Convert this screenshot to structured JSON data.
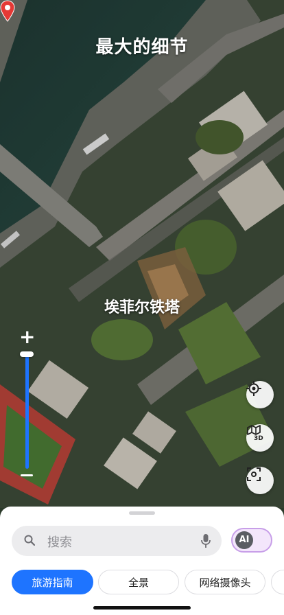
{
  "map": {
    "headline": "最大的细节",
    "place_label": "埃菲尔铁塔"
  },
  "controls": {
    "zoom_level_fraction": 1.0,
    "locate": "locate-icon",
    "map_3d": "map-3d-icon",
    "fullscreen": "fullscreen-icon"
  },
  "search": {
    "placeholder": "搜索",
    "ai_label": "AI"
  },
  "chips": [
    {
      "label": "旅游指南",
      "active": true
    },
    {
      "label": "全景",
      "active": false
    },
    {
      "label": "网络摄像头",
      "active": false
    }
  ],
  "colors": {
    "accent": "#1e74ff",
    "pin": "#e53935",
    "ai_border": "#c79ee8"
  }
}
